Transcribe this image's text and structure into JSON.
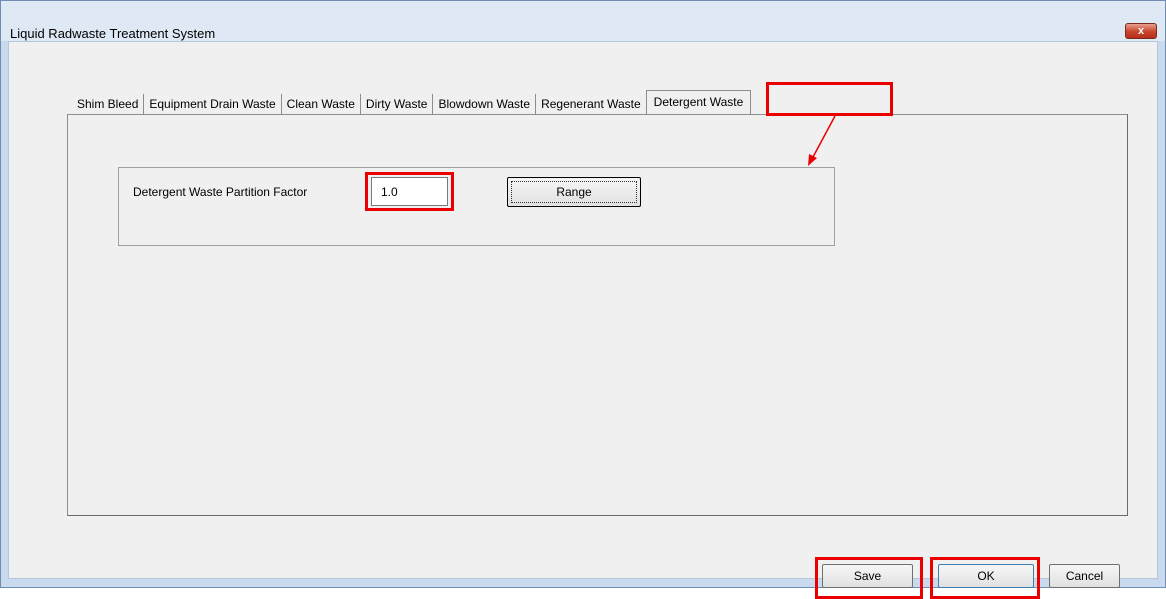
{
  "window": {
    "title": "Liquid Radwaste Treatment System",
    "close_glyph": "x"
  },
  "tabs": [
    {
      "label": "Shim Bleed"
    },
    {
      "label": "Equipment Drain Waste"
    },
    {
      "label": "Clean Waste"
    },
    {
      "label": "Dirty Waste"
    },
    {
      "label": "Blowdown Waste"
    },
    {
      "label": "Regenerant Waste"
    },
    {
      "label": "Detergent Waste",
      "active": true
    }
  ],
  "panel": {
    "field_label": "Detergent Waste Partition Factor",
    "field_value": "1.0",
    "range_label": "Range"
  },
  "footer": {
    "save_label": "Save",
    "ok_label": "OK",
    "cancel_label": "Cancel"
  },
  "annotation_color": "#ea0000"
}
